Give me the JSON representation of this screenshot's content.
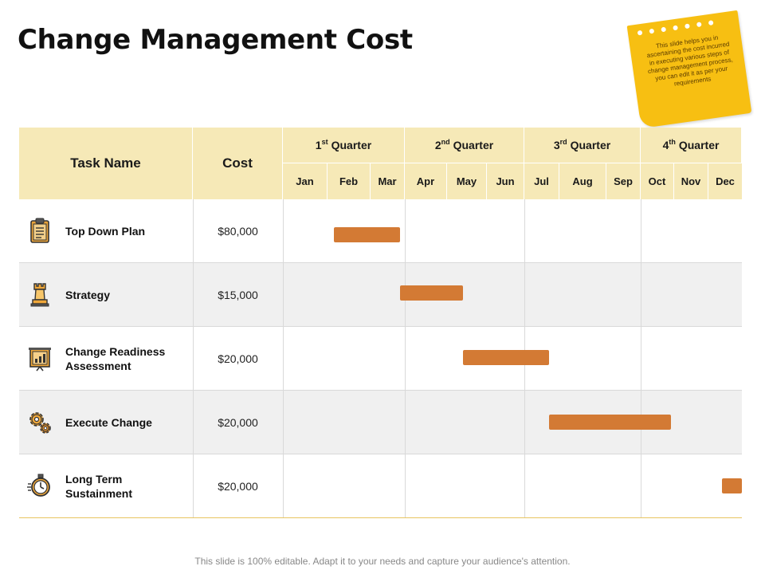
{
  "title": "Change Management Cost",
  "sticky_note": "This slide helps you in ascertaining the cost incurred in executing various steps of change management process, you can edit it as per your requirements",
  "table": {
    "task_header": "Task Name",
    "cost_header": "Cost",
    "quarters": [
      {
        "num": "1",
        "sup": "st",
        "label": "Quarter"
      },
      {
        "num": "2",
        "sup": "nd",
        "label": "Quarter"
      },
      {
        "num": "3",
        "sup": "rd",
        "label": "Quarter"
      },
      {
        "num": "4",
        "sup": "th",
        "label": "Quarter"
      }
    ],
    "months": [
      "Jan",
      "Feb",
      "Mar",
      "Apr",
      "May",
      "Jun",
      "Jul",
      "Aug",
      "Sep",
      "Oct",
      "Nov",
      "Dec"
    ],
    "rows": [
      {
        "icon": "clipboard-icon",
        "task_line1": "Top Down Plan",
        "task_line2": "",
        "cost": "$80,000",
        "bar_start_month": 1.15,
        "bar_end_month": 2.85
      },
      {
        "icon": "chess-rook-icon",
        "task_line1": "Strategy",
        "task_line2": "",
        "cost": "$15,000",
        "bar_start_month": 2.85,
        "bar_end_month": 4.4
      },
      {
        "icon": "chart-board-icon",
        "task_line1": "Change Readiness",
        "task_line2": "Assessment",
        "cost": "$20,000",
        "bar_start_month": 4.4,
        "bar_end_month": 6.7
      },
      {
        "icon": "gears-icon",
        "task_line1": "Execute Change",
        "task_line2": "",
        "cost": "$20,000",
        "bar_start_month": 6.7,
        "bar_end_month": 9.9
      },
      {
        "icon": "stopwatch-icon",
        "task_line1": "Long Term",
        "task_line2": "Sustainment",
        "cost": "$20,000",
        "bar_start_month": 11.4,
        "bar_end_month": 12.2
      }
    ]
  },
  "footer": "This slide is 100% editable. Adapt it to your needs and capture your audience's attention.",
  "colors": {
    "header_bg": "#f6e9b7",
    "bar": "#d37a34",
    "sticky": "#f7bf12",
    "alt_row": "#f0f0f0"
  }
}
